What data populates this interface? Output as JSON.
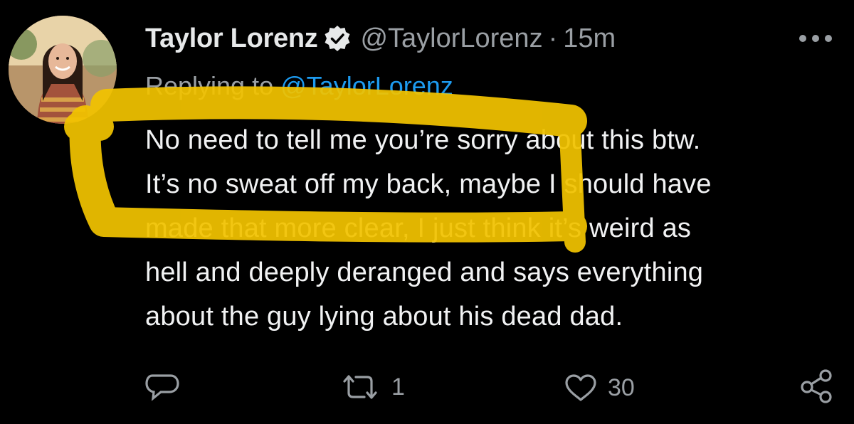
{
  "author": {
    "display_name": "Taylor Lorenz",
    "handle": "@TaylorLorenz",
    "separator": "·",
    "time": "15m",
    "verified": true,
    "avatar_icon": "profile-photo"
  },
  "reply_context": {
    "prefix": "Replying to",
    "mention": "@TaylorLorenz"
  },
  "body_lines": [
    "No need to tell me you’re sorry about this btw.",
    "It’s no sweat off my back, maybe I should have",
    "made that more clear, I just think it’s weird as",
    "hell and deeply deranged and says everything",
    "about the guy lying about his dead dad."
  ],
  "actions": {
    "reply_icon": "comment-icon",
    "retweet_icon": "retweet-icon",
    "retweet_count": "1",
    "like_icon": "heart-icon",
    "like_count": "30",
    "share_icon": "share-icon"
  },
  "colors": {
    "background": "#000000",
    "text_primary": "#e7e9ea",
    "text_secondary": "#9a9fa4",
    "mention": "#1d9bf0",
    "highlight": "#f2c300"
  }
}
